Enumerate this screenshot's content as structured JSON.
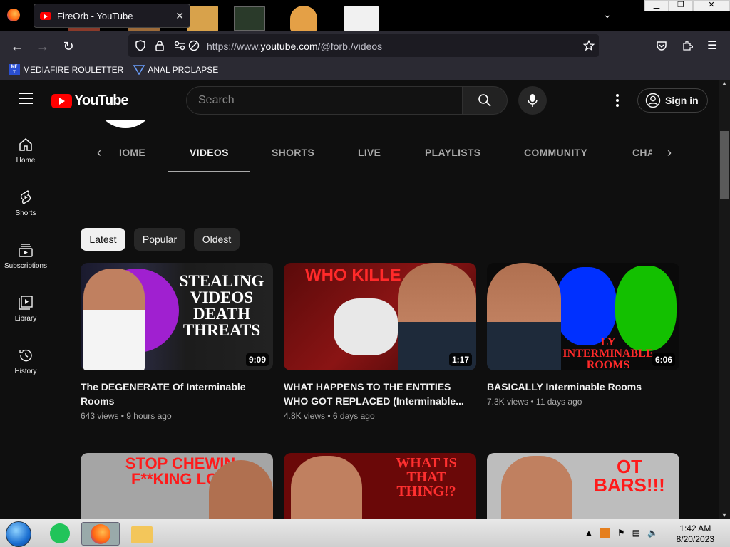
{
  "browser": {
    "tab_title": "FireOrb - YouTube",
    "tab_close": "✕",
    "url_prefix": "https://www.",
    "url_domain": "youtube.com",
    "url_path": "/@forb./videos",
    "bookmarks": [
      {
        "label": "MEDIAFIRE ROULETTER",
        "icon": "mft-icon"
      },
      {
        "label": "ANAL PROLAPSE",
        "icon": "bookmark-folder-icon"
      }
    ],
    "window_controls": {
      "minimize": "▁",
      "maximize": "❐",
      "close": "✕"
    }
  },
  "youtube": {
    "logo_text": "YouTube",
    "search_placeholder": "Search",
    "sign_in": "Sign in",
    "sidebar": [
      {
        "label": "Home",
        "icon": "home-icon"
      },
      {
        "label": "Shorts",
        "icon": "shorts-icon"
      },
      {
        "label": "Subscriptions",
        "icon": "subscriptions-icon"
      },
      {
        "label": "Library",
        "icon": "library-icon"
      },
      {
        "label": "History",
        "icon": "history-icon"
      }
    ],
    "channel_tabs": [
      "IOME",
      "VIDEOS",
      "SHORTS",
      "LIVE",
      "PLAYLISTS",
      "COMMUNITY",
      "CHA"
    ],
    "active_tab": "VIDEOS",
    "sort_chips": [
      "Latest",
      "Popular",
      "Oldest"
    ],
    "active_chip": "Latest",
    "videos": [
      {
        "title": "The DEGENERATE Of Interminable Rooms",
        "views": "643 views",
        "age": "9 hours ago",
        "duration": "9:09",
        "thumb_text": "STEALING VIDEOS DEATH THREATS"
      },
      {
        "title": "WHAT HAPPENS TO THE ENTITIES WHO GOT REPLACED (Interminable...",
        "views": "4.8K views",
        "age": "6 days ago",
        "duration": "1:17",
        "thumb_text": "WHO KILLE"
      },
      {
        "title": "BASICALLY Interminable Rooms",
        "views": "7.3K views",
        "age": "11 days ago",
        "duration": "6:06",
        "thumb_text": "LY INTERMINABLE ROOMS"
      },
      {
        "title": "",
        "views": "",
        "age": "",
        "duration": "",
        "thumb_text": "STOP CHEWIN F**KING LOU"
      },
      {
        "title": "",
        "views": "",
        "age": "",
        "duration": "",
        "thumb_text": "WHAT IS THAT THING!?"
      },
      {
        "title": "",
        "views": "",
        "age": "",
        "duration": "",
        "thumb_text": "OT BARS!!!"
      }
    ],
    "meta_separator": "•"
  },
  "taskbar": {
    "time": "1:42 AM",
    "date": "8/20/2023"
  },
  "colors": {
    "yt_bg": "#0f0f0f",
    "yt_red": "#ff0000",
    "chrome_bg": "#2b2a33"
  }
}
